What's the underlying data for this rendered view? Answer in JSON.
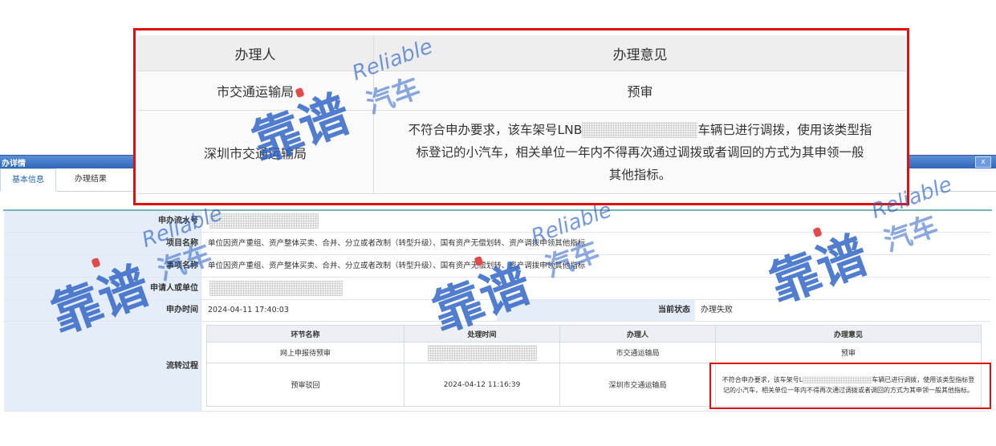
{
  "window": {
    "title": "办详情",
    "close_label": "x"
  },
  "tabs": [
    {
      "label": "基本信息"
    },
    {
      "label": "办理结果"
    }
  ],
  "form": {
    "serial_label": "申办流水号",
    "project_label": "项目名称",
    "project_value": "单位因资产重组、资产整体买卖、合并、分立或者改制（转型升级）、国有资产无偿划转、资产调拨申领其他指标",
    "item_label": "事项名称",
    "item_value": "单位因资产重组、资产整体买卖、合并、分立或者改制（转型升级）、国有资产无偿划转、资产调拨申领其他指标",
    "applicant_label": "申请人或单位",
    "time_label": "申办时间",
    "time_value": "2024-04-11 17:40:03",
    "status_label": "当前状态",
    "status_value": "办理失败",
    "flow_label": "流转过程"
  },
  "flow_table": {
    "headers": [
      "环节名称",
      "处理时间",
      "办理人",
      "办理意见"
    ],
    "rows": [
      {
        "step": "网上申报待预审",
        "time": "",
        "handler": "市交通运输局",
        "opinion": "预审"
      },
      {
        "step": "预审驳回",
        "time": "2024-04-12 11:16:39",
        "handler": "深圳市交通运输局",
        "opinion_a": "不符合申办要求，该车架号L",
        "opinion_b": "车辆已进行调拨，使用该类型指标登记的小汽车，相关单位一年内不得再次通过调拨或者调回的方式为其申领一般其他指标。"
      }
    ]
  },
  "zoom": {
    "headers": [
      "办理人",
      "办理意见"
    ],
    "rows": [
      {
        "handler": "市交通运输局",
        "opinion": "预审"
      },
      {
        "handler": "深圳市交通运输局",
        "opinion_line1_a": "不符合申办要求，该车架号LNB",
        "opinion_line1_b": "车辆已进行调拨，使用该类型指",
        "opinion_line2": "标登记的小汽车，相关单位一年内不得再次通过调拨或者调回的方式为其申领一般",
        "opinion_line3": "其他指标。"
      }
    ]
  },
  "watermark": {
    "cn": "靠谱",
    "en": "Reliable",
    "sub": "汽车"
  },
  "colors": {
    "highlight": "#e01010",
    "titlebar": "#2f66b8",
    "label_bg": "#e5edf8",
    "watermark": "#2c62c4"
  }
}
